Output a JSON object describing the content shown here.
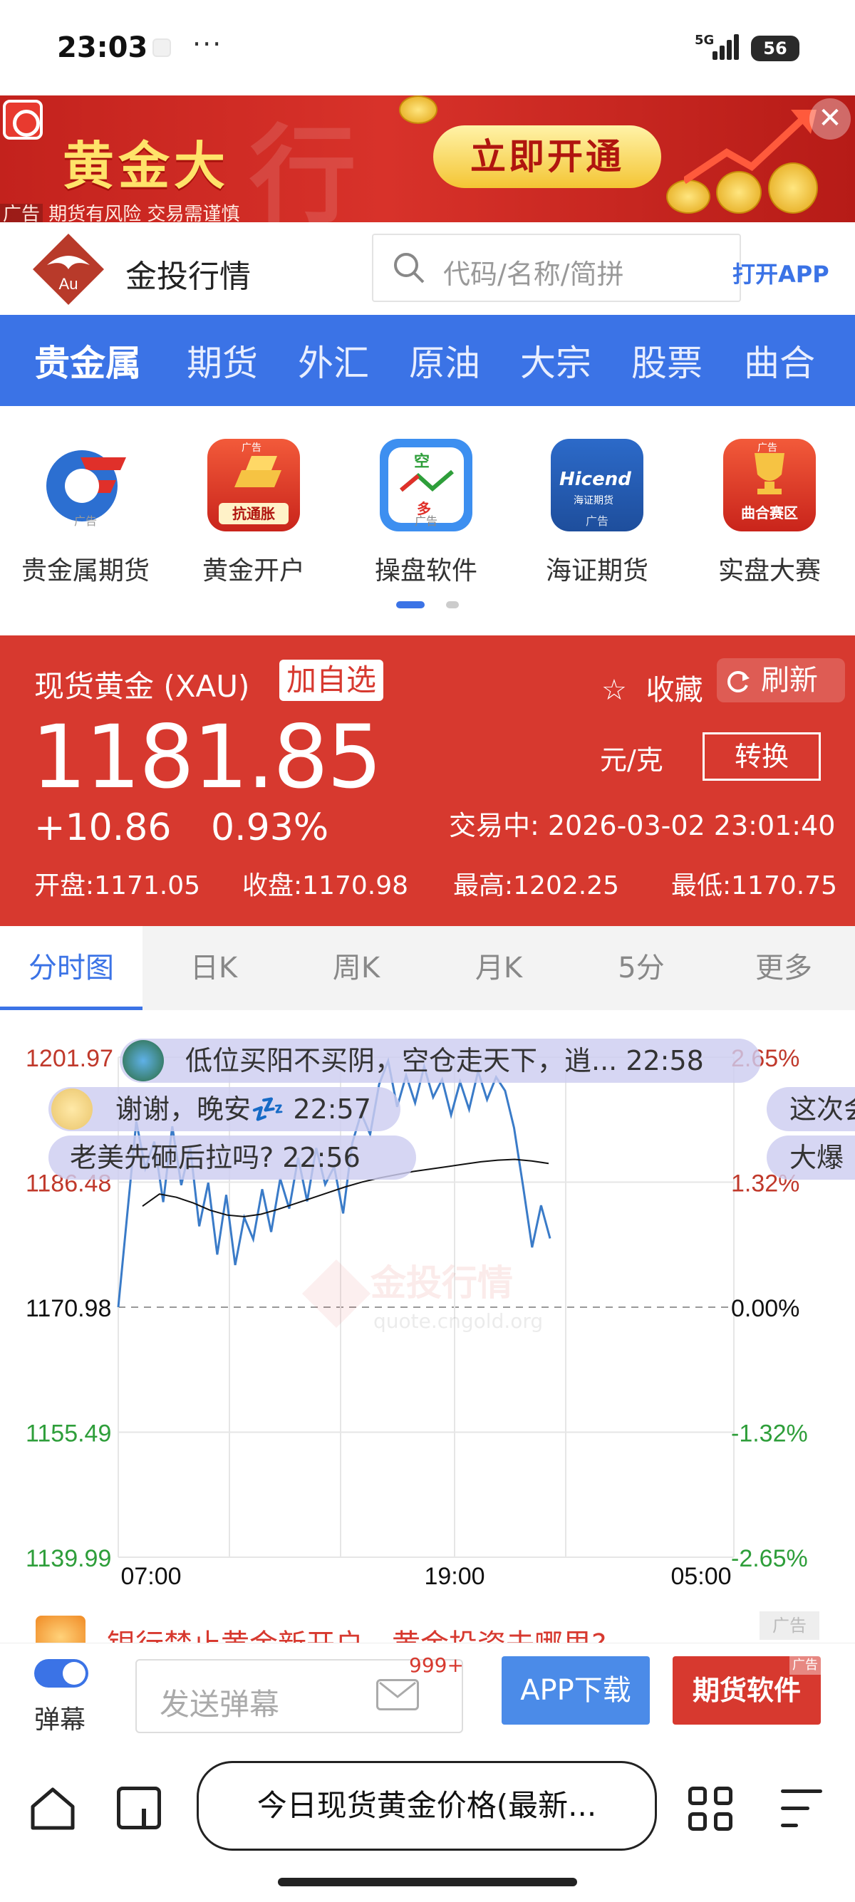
{
  "status_bar": {
    "time": "23:03",
    "dots": "···",
    "network": "5G",
    "battery": "56"
  },
  "ad_banner": {
    "title": "黄金大",
    "bg_text": "行",
    "cta": "立即开通",
    "ad_label": "广告",
    "disclaimer": "期货有风险 交易需谨慎",
    "close": "✕"
  },
  "header": {
    "brand": "金投行情",
    "logo_text": "Au",
    "search_placeholder": "代码/名称/简拼",
    "open_app": "打开APP"
  },
  "nav": {
    "items": [
      "贵金属",
      "期货",
      "外汇",
      "原油",
      "大宗",
      "股票",
      "曲合"
    ],
    "active": 0
  },
  "shortcuts": [
    {
      "label": "贵金属期货",
      "ad": "广告"
    },
    {
      "label": "黄金开户",
      "ad": "广告",
      "sub": "抗通胀"
    },
    {
      "label": "操盘软件",
      "ad": "广告",
      "top": "空",
      "bottom": "多"
    },
    {
      "label": "海证期货",
      "ad": "广告",
      "brand": "Hicend",
      "brand_sub": "海证期货"
    },
    {
      "label": "实盘大赛",
      "ad": "广告",
      "sub": "曲合赛区"
    }
  ],
  "quote": {
    "name": "现货黄金 (XAU)",
    "add_watch": "加自选",
    "favorite": "收藏",
    "refresh": "刷新",
    "price": "1181.85",
    "change": "+10.86",
    "change_pct": "0.93%",
    "unit": "元/克",
    "convert": "转换",
    "status": "交易中:  2026-03-02 23:01:40",
    "open": "开盘:1171.05",
    "close": "收盘:1170.98",
    "high": "最高:1202.25",
    "low": "最低:1170.75"
  },
  "chart_tabs": [
    "分时图",
    "日K",
    "周K",
    "月K",
    "5分",
    "更多"
  ],
  "chart_data": {
    "type": "line",
    "title": "",
    "xlabel": "",
    "ylabel": "",
    "x_ticks": [
      "07:00",
      "19:00",
      "05:00"
    ],
    "y_ticks_left": [
      "1201.97",
      "1186.48",
      "1170.98",
      "1155.49",
      "1139.99"
    ],
    "y_ticks_right": [
      "2.65%",
      "1.32%",
      "0.00%",
      "-1.32%",
      "-2.65%"
    ],
    "ylim": [
      1139.99,
      1201.97
    ],
    "baseline": 1170.98,
    "grid": true,
    "colors": {
      "price": "#3a7bc8",
      "avg": "#111111",
      "up": "#c0392b",
      "down": "#2e9e3a",
      "flat": "#111111"
    },
    "watermark": "金投行情",
    "watermark_url": "quote.cngold.org",
    "series": [
      {
        "values": [
          1170.98,
          1182.5,
          1194.0,
          1188.2,
          1191.5,
          1184.0,
          1193.4,
          1186.1,
          1190.8,
          1181.0,
          1186.4,
          1177.5,
          1184.9,
          1176.2,
          1182.1,
          1179.4,
          1185.6,
          1180.3,
          1186.9,
          1183.2,
          1189.5,
          1184.1,
          1190.7,
          1186.2,
          1188.4,
          1182.6,
          1191.3,
          1195.0,
          1192.4,
          1198.6,
          1201.5,
          1195.8,
          1199.7,
          1196.3,
          1200.8,
          1197.0,
          1199.2,
          1194.8,
          1198.9,
          1195.5,
          1200.2,
          1196.7,
          1199.5,
          1197.8,
          1193.2,
          1186.0,
          1178.4,
          1183.6,
          1179.5
        ]
      },
      {
        "values": [
          1183.5,
          1185.0,
          1184.6,
          1183.9,
          1183.0,
          1182.4,
          1182.2,
          1182.5,
          1183.1,
          1183.8,
          1184.5,
          1185.2,
          1185.9,
          1186.5,
          1187.0,
          1187.4,
          1187.8,
          1188.1,
          1188.4,
          1188.7,
          1189.0,
          1189.2,
          1189.3,
          1189.1,
          1188.8
        ]
      }
    ]
  },
  "danmaku": [
    {
      "text": "低位买阳不买阴，空仓走天下，逍...  22:58"
    },
    {
      "text": "谢谢，晚安💤  22:57"
    },
    {
      "text": "老美先砸后拉吗?  22:56"
    },
    {
      "text": "这次会"
    },
    {
      "text": "大爆"
    }
  ],
  "news": {
    "text": "银行禁止黄金新开户，黄金投资去哪里?",
    "ad": "广告"
  },
  "interaction_bar": {
    "toggle_label": "弹幕",
    "input_placeholder": "发送弹幕",
    "badge": "999+",
    "app_download": "APP下载",
    "futures_software": "期货软件",
    "ad": "广告"
  },
  "browser": {
    "url_text": "今日现货黄金价格(最新..."
  }
}
